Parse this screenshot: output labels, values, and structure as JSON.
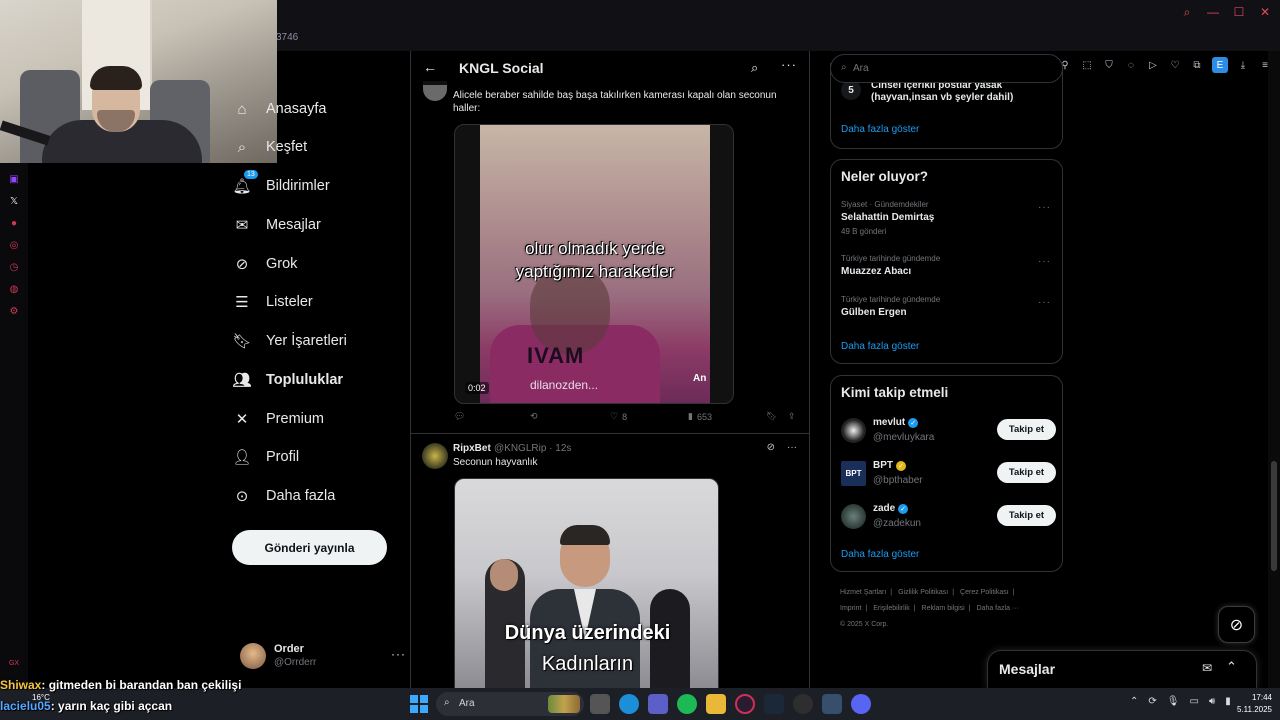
{
  "browser": {
    "addr_fragment": "3746"
  },
  "webcam": {},
  "nav": {
    "items": [
      {
        "label": "Anasayfa",
        "icon": "home-icon"
      },
      {
        "label": "Keşfet",
        "icon": "search-icon"
      },
      {
        "label": "Bildirimler",
        "icon": "bell-icon",
        "badge": "13"
      },
      {
        "label": "Mesajlar",
        "icon": "mail-icon"
      },
      {
        "label": "Grok",
        "icon": "grok-icon"
      },
      {
        "label": "Listeler",
        "icon": "list-icon"
      },
      {
        "label": "Yer İşaretleri",
        "icon": "bookmark-icon"
      },
      {
        "label": "Topluluklar",
        "icon": "communities-icon"
      },
      {
        "label": "Premium",
        "icon": "x-logo-icon"
      },
      {
        "label": "Profil",
        "icon": "person-icon"
      },
      {
        "label": "Daha fazla",
        "icon": "more-circle-icon"
      }
    ],
    "post_button": "Gönderi yayınla",
    "account": {
      "name": "Order",
      "handle": "@Orrderr"
    }
  },
  "main": {
    "title": "KNGL Social",
    "post1": {
      "text": "Alicele beraber sahilde baş başa takılırken kamerası kapalı olan seconun haller:",
      "video_caption_1": "olur olmadık yerde",
      "video_caption_2": "yaptığımız haraketler",
      "video_shirt_text": "IVAM",
      "video_watermark": "dilanozden...",
      "video_watermark_2": "An",
      "video_time": "0:02",
      "likes": "8",
      "views": "653"
    },
    "post2": {
      "name": "RipxBet",
      "meta": "@KNGLRip · 12s",
      "text": "Seconun hayvanlık",
      "image_caption_1": "Dünya üzerindeki",
      "image_caption_2": "Kadınların"
    }
  },
  "sidebar": {
    "search_placeholder": "Ara",
    "rules": {
      "number": "5",
      "line1": "Cinsel içerikli postlar yasak",
      "line2": "(hayvan,insan vb şeyler dahil)",
      "more": "Daha fazla göster"
    },
    "trends": {
      "title": "Neler oluyor?",
      "items": [
        {
          "category": "Siyaset · Gündemdekiler",
          "topic": "Selahattin Demirtaş",
          "count": "49 B gönderi"
        },
        {
          "category": "Türkiye tarihinde gündemde",
          "topic": "Muazzez Abacı",
          "count": ""
        },
        {
          "category": "Türkiye tarihinde gündemde",
          "topic": "Gülben Ergen",
          "count": ""
        }
      ],
      "more": "Daha fazla göster"
    },
    "who_to_follow": {
      "title": "Kimi takip etmeli",
      "button": "Takip et",
      "items": [
        {
          "name": "mevlut",
          "handle": "@mevluykara",
          "badge": "blue"
        },
        {
          "name": "BPT",
          "handle": "@bpthaber",
          "badge": "gold"
        },
        {
          "name": "zade",
          "handle": "@zadekun",
          "badge": "blue"
        }
      ],
      "more": "Daha fazla göster"
    },
    "footer": {
      "links": [
        "Hizmet Şartları",
        "|",
        "Gizlilik Politikası",
        "|",
        "Çerez Politikası",
        "|",
        "Imprint",
        "|",
        "Erişilebilirlik",
        "|",
        "Reklam bilgisi",
        "|",
        "Daha fazla ···"
      ],
      "copyright": "© 2025 X Corp."
    }
  },
  "messages_bar": {
    "title": "Mesajlar"
  },
  "chat": [
    {
      "user": "Shiwax",
      "msg": ": gitmeden bi barandan ban çekilişi"
    },
    {
      "user": "lacielu05",
      "msg": ": yarın kaç gibi açcan"
    }
  ],
  "taskbar": {
    "search_placeholder": "Ara",
    "weather": "16°C",
    "time": "17:44",
    "date": "5.11.2025"
  },
  "colors": {
    "accent": "#1d9bf0",
    "background": "#000000",
    "border": "#2f3336",
    "muted": "#71767b"
  }
}
